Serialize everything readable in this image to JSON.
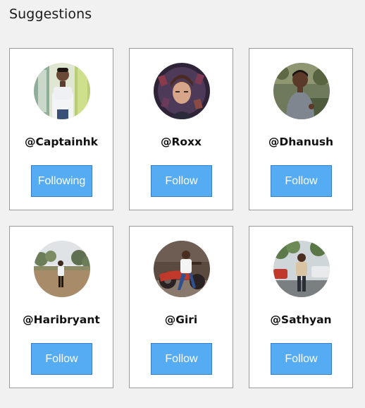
{
  "heading": "Suggestions",
  "accent_color": "#56acf3",
  "users": [
    {
      "username": "@Captainhk",
      "button": "Following"
    },
    {
      "username": "@Roxx",
      "button": "Follow"
    },
    {
      "username": "@Dhanush",
      "button": "Follow"
    },
    {
      "username": "@Haribryant",
      "button": "Follow"
    },
    {
      "username": "@Giri",
      "button": "Follow"
    },
    {
      "username": "@Sathyan",
      "button": "Follow"
    }
  ]
}
